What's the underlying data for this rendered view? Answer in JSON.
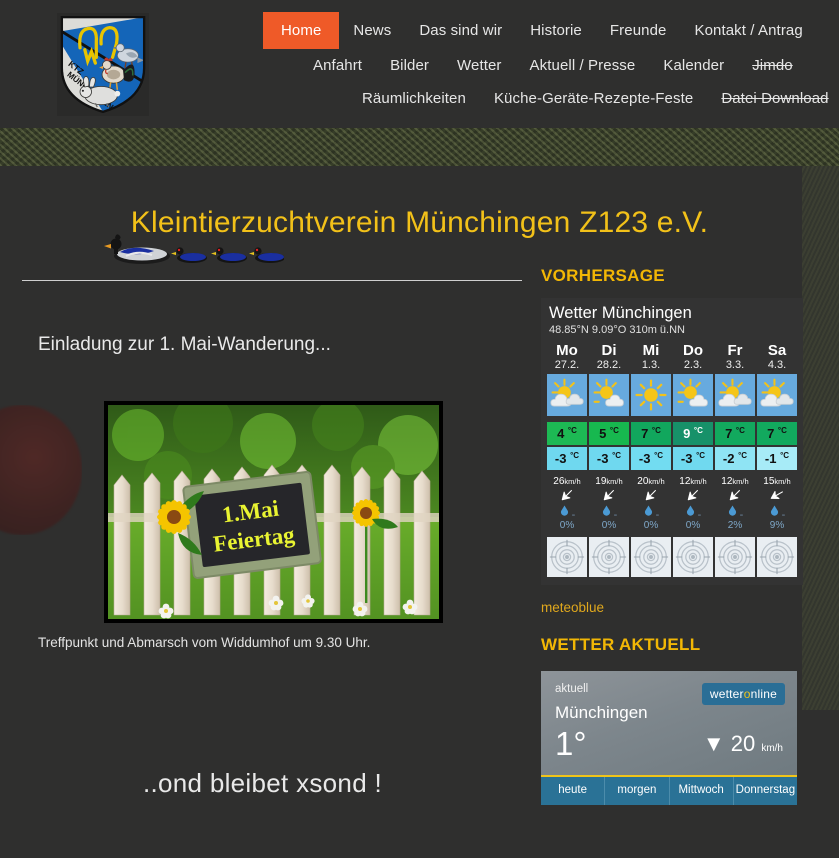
{
  "site": {
    "logo_alt": "KTZ Münchingen Z123 Wappen",
    "logo_text_top": "KTZ",
    "logo_text_main": "MÜNCHINGEN Z123"
  },
  "nav": {
    "row1": [
      {
        "label": "Home",
        "active": true,
        "struck": false
      },
      {
        "label": "News",
        "active": false,
        "struck": false
      },
      {
        "label": "Das sind wir",
        "active": false,
        "struck": false
      },
      {
        "label": "Historie",
        "active": false,
        "struck": false
      },
      {
        "label": "Freunde",
        "active": false,
        "struck": false
      },
      {
        "label": "Kontakt / Antrag",
        "active": false,
        "struck": false
      }
    ],
    "row2": [
      {
        "label": "Anfahrt",
        "active": false,
        "struck": false
      },
      {
        "label": "Bilder",
        "active": false,
        "struck": false
      },
      {
        "label": "Wetter",
        "active": false,
        "struck": false
      },
      {
        "label": "Aktuell / Presse",
        "active": false,
        "struck": false
      },
      {
        "label": "Kalender",
        "active": false,
        "struck": false
      },
      {
        "label": "Jimdo",
        "active": false,
        "struck": true
      }
    ],
    "row3": [
      {
        "label": "Räumlichkeiten",
        "active": false,
        "struck": false
      },
      {
        "label": "Küche-Geräte-Rezepte-Feste",
        "active": false,
        "struck": false
      },
      {
        "label": "Datei Download",
        "active": false,
        "struck": true
      }
    ]
  },
  "page": {
    "title": "Kleintierzuchtverein Münchingen Z123 e.V.",
    "invite_heading": "Einladung zur 1. Mai-Wanderung...",
    "photo_sign_line1": "1.Mai",
    "photo_sign_line2": "Feiertag",
    "photo_caption": "Treffpunkt und Abmarsch vom Widdumhof um 9.30 Uhr.",
    "slogan": "..ond bleibet xsond !"
  },
  "sidebar": {
    "forecast_heading": "VORHERSAGE",
    "current_heading": "WETTER AKTUELL",
    "meteoblue_link": "meteoblue"
  },
  "meteoblue": {
    "city": "Wetter Münchingen",
    "coords": "48.85°N 9.09°O 310m ü.NN",
    "days": [
      {
        "name": "Mo",
        "date": "27.2.",
        "icon": "partly-cloudy-icon",
        "tmax": "4",
        "tmin": "-3",
        "tmax_color": "#1db954",
        "tmin_color": "#6fd8ef",
        "wind": "26",
        "wind_unit": "km/h",
        "wind_dir": 225,
        "precip": "0",
        "precip_unit": "%"
      },
      {
        "name": "Di",
        "date": "28.2.",
        "icon": "sun-small-cloud-icon",
        "tmax": "5",
        "tmin": "-3",
        "tmax_color": "#17b84f",
        "tmin_color": "#6fd8ef",
        "wind": "19",
        "wind_unit": "km/h",
        "wind_dir": 225,
        "precip": "0",
        "precip_unit": "%"
      },
      {
        "name": "Mi",
        "date": "1.3.",
        "icon": "sun-icon",
        "tmax": "7",
        "tmin": "-3",
        "tmax_color": "#11a75d",
        "tmin_color": "#72dcf1",
        "wind": "20",
        "wind_unit": "km/h",
        "wind_dir": 225,
        "precip": "0",
        "precip_unit": "%"
      },
      {
        "name": "Do",
        "date": "2.3.",
        "icon": "sun-small-cloud-icon",
        "tmax": "9",
        "tmin": "-3",
        "tmax_color": "#179169",
        "tmin_color": "#70d9ef",
        "wind": "12",
        "wind_unit": "km/h",
        "wind_dir": 225,
        "precip": "0",
        "precip_unit": "%"
      },
      {
        "name": "Fr",
        "date": "3.3.",
        "icon": "partly-cloudy-icon",
        "tmax": "7",
        "tmin": "-2",
        "tmax_color": "#12a95e",
        "tmin_color": "#8fe4f4",
        "wind": "12",
        "wind_unit": "km/h",
        "wind_dir": 225,
        "precip": "2",
        "precip_unit": "%"
      },
      {
        "name": "Sa",
        "date": "4.3.",
        "icon": "partly-cloudy-icon",
        "tmax": "7",
        "tmin": "-1",
        "tmax_color": "#12a95e",
        "tmin_color": "#a7ebf7",
        "wind": "15",
        "wind_unit": "km/h",
        "wind_dir": 240,
        "precip": "9",
        "precip_unit": "%"
      }
    ],
    "temp_unit": "°C"
  },
  "wetteronline": {
    "label": "aktuell",
    "city": "Münchingen",
    "temp": "1°",
    "wind_value": "20",
    "wind_unit": "km/h",
    "wind_arrow": "▼",
    "brand_a": "wetter",
    "brand_o": "o",
    "brand_b": "nline",
    "tabs": [
      "heute",
      "morgen",
      "Mittwoch",
      "Donnerstag"
    ]
  },
  "colors": {
    "accent_orange": "#ef5a28",
    "heading_yellow": "#f2b705",
    "title_yellow": "#f2c119",
    "page_bg": "#2f2f2e"
  }
}
